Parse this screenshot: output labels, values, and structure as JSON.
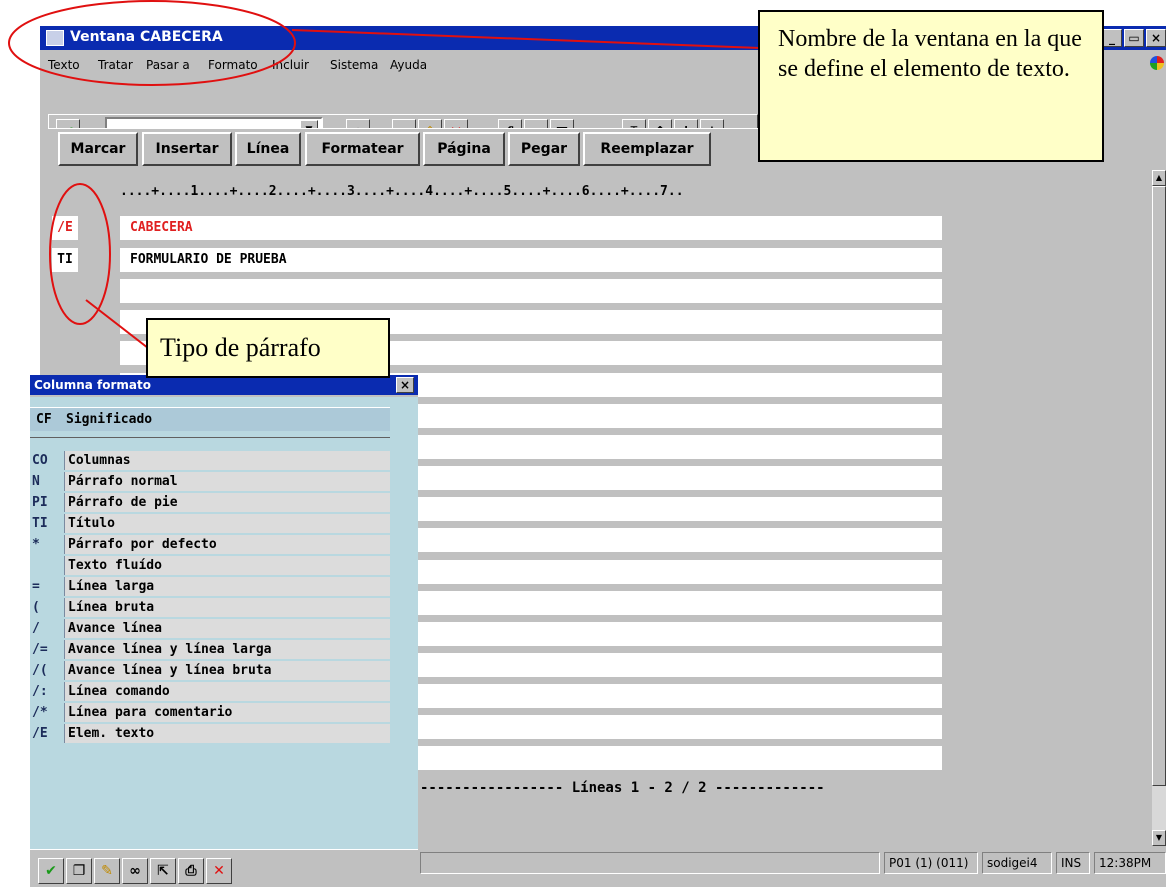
{
  "window": {
    "title": "Ventana CABECERA",
    "controls": [
      "_",
      "▭",
      "×"
    ]
  },
  "menu": [
    "Texto",
    "Tratar",
    "Pasar a",
    "Formato",
    "Incluir",
    "Sistema",
    "Ayuda"
  ],
  "toolbar": {
    "command_value": "",
    "icons": [
      "check-icon",
      "dropdown-icon",
      "save-icon",
      "back-icon",
      "exit-icon",
      "cancel-icon",
      "print-icon",
      "find-icon",
      "find-next-icon",
      "first-page-icon",
      "prev-page-icon",
      "next-page-icon",
      "last-page-icon"
    ]
  },
  "app_buttons": [
    "Marcar",
    "Insertar",
    "Línea",
    "Formatear",
    "Página",
    "Pegar",
    "Reemplazar"
  ],
  "editor": {
    "ruler": "....+....1....+....2....+....3....+....4....+....5....+....6....+....7..",
    "lines": [
      {
        "format": "/E",
        "text": "CABECERA",
        "color": "#e02020"
      },
      {
        "format": "TI",
        "text": "FORMULARIO DE PRUEBA",
        "color": "#000000"
      }
    ],
    "footer": "----------------- Líneas 1 - 2 / 2 -------------"
  },
  "status_bar": {
    "system": "P01 (1) (011)",
    "server": "sodigei4",
    "mode": "INS",
    "time": "12:38PM"
  },
  "popup": {
    "title": "Columna formato",
    "col_cf": "CF",
    "col_meaning": "Significado",
    "rows": [
      {
        "cf": "CO",
        "desc": "Columnas"
      },
      {
        "cf": "N",
        "desc": "Párrafo normal"
      },
      {
        "cf": "PI",
        "desc": "Párrafo de pie"
      },
      {
        "cf": "TI",
        "desc": "Título"
      },
      {
        "cf": "*",
        "desc": "Párrafo por defecto"
      },
      {
        "cf": "",
        "desc": "Texto fluído"
      },
      {
        "cf": "=",
        "desc": "Línea larga"
      },
      {
        "cf": "(",
        "desc": "Línea bruta"
      },
      {
        "cf": "/",
        "desc": "Avance línea"
      },
      {
        "cf": "/=",
        "desc": "Avance línea y línea larga"
      },
      {
        "cf": "/(",
        "desc": "Avance línea y línea bruta"
      },
      {
        "cf": "/:",
        "desc": "Línea comando"
      },
      {
        "cf": "/*",
        "desc": "Línea para comentario"
      },
      {
        "cf": "/E",
        "desc": "Elem. texto"
      }
    ],
    "toolbar_icons": [
      "check-icon",
      "copy-icon",
      "edit-icon",
      "find-icon",
      "select-icon",
      "print-icon",
      "cancel-icon"
    ]
  },
  "callouts": {
    "window_name": "Nombre de la ventana en la que se define el elemento de texto.",
    "paragraph_type": "Tipo de párrafo"
  },
  "colors": {
    "titlebar": "#0a2bb0",
    "callout_bg": "#ffffc8",
    "annotation_ellipse": "#e01010",
    "popup_body": "#b9d8e0"
  }
}
